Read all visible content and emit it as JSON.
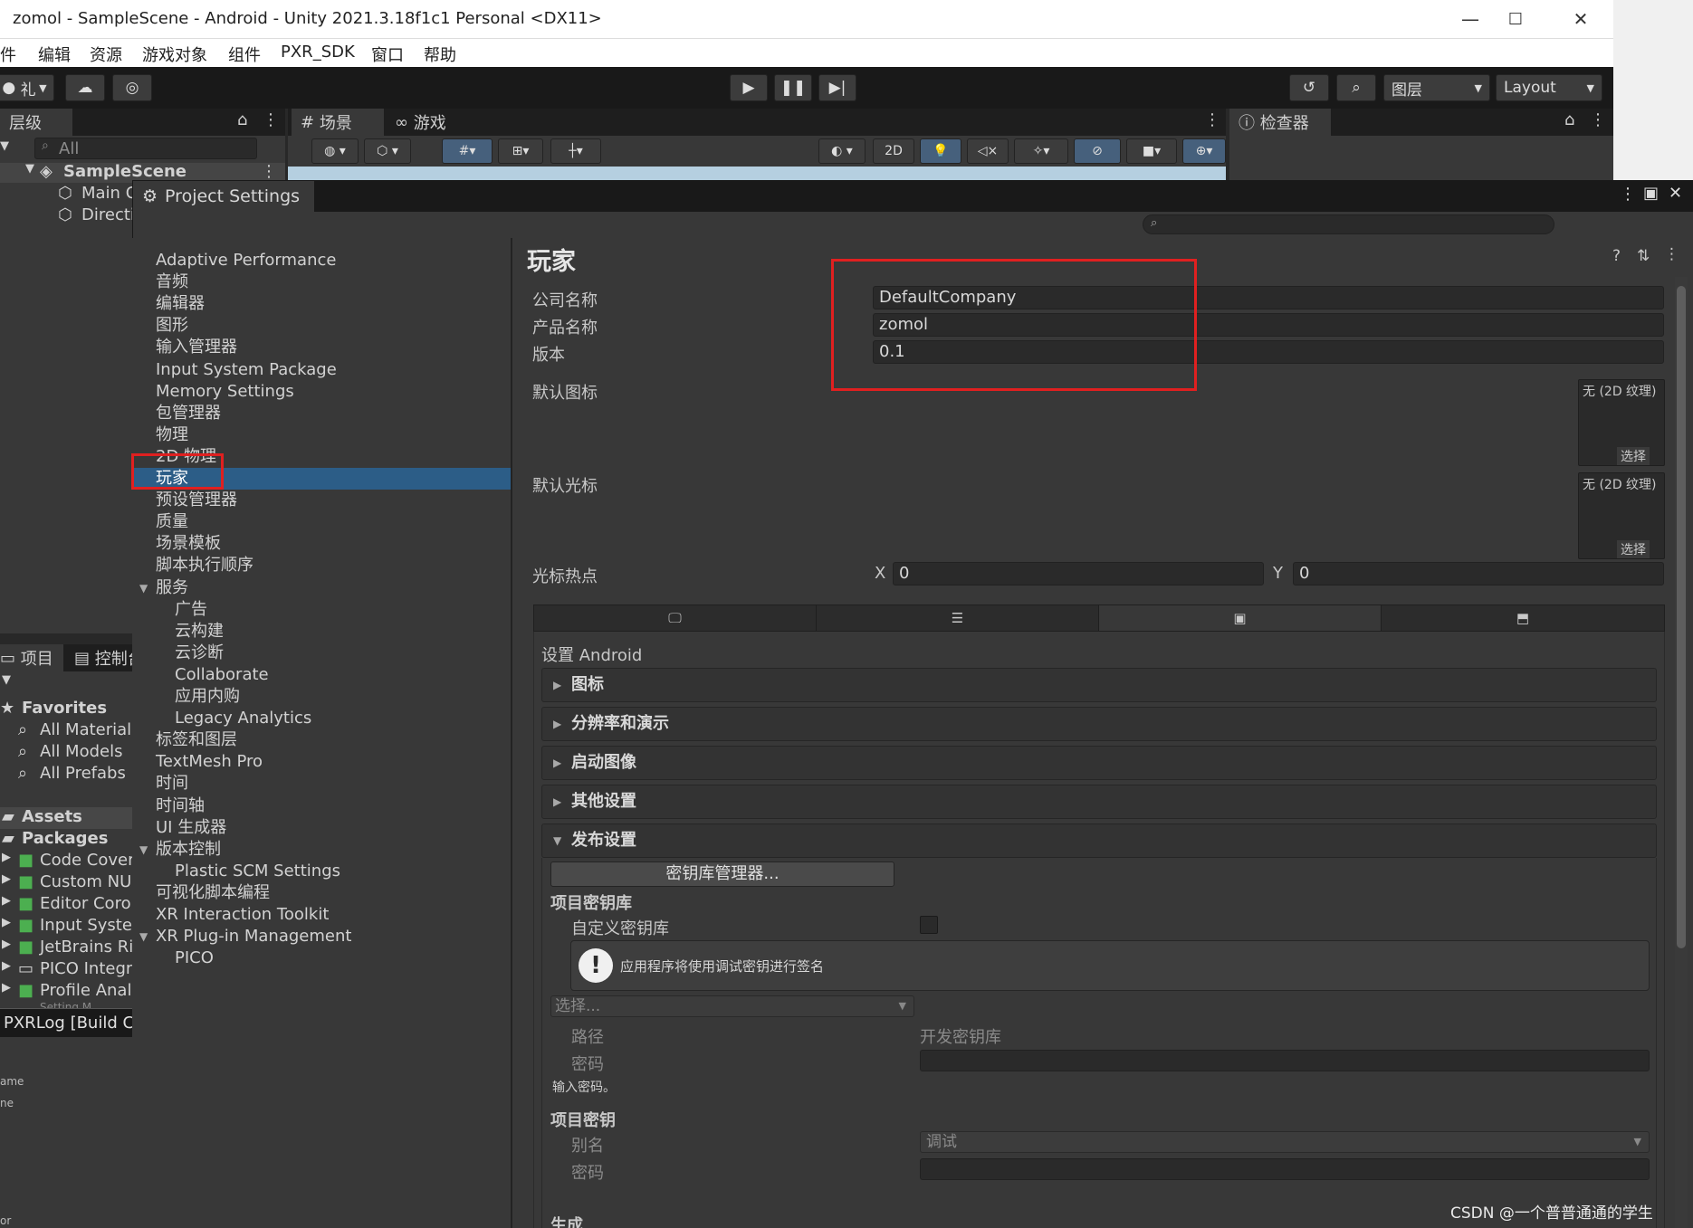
{
  "window": {
    "title": "zomol - SampleScene - Android - Unity 2021.3.18f1c1 Personal <DX11>",
    "minimize": "—",
    "maximize": "☐",
    "close": "✕"
  },
  "menu": [
    "件",
    "编辑",
    "资源",
    "游戏对象",
    "组件",
    "PXR_SDK",
    "窗口",
    "帮助"
  ],
  "toolbar": {
    "account_label": "礼",
    "layers_label": "图层",
    "layout_label": "Layout"
  },
  "hierarchy": {
    "tab": "层级",
    "search_placeholder": "All",
    "scene": "SampleScene",
    "items": [
      "Main C",
      "Directi"
    ]
  },
  "scene_tabs": [
    "场景",
    "游戏"
  ],
  "scene_toolbar": {
    "mode_2d": "2D"
  },
  "inspector": {
    "tab": "检查器"
  },
  "project": {
    "tabs": [
      "项目",
      "控制台"
    ],
    "favorites_label": "Favorites",
    "favorites": [
      "All Material",
      "All Models",
      "All Prefabs"
    ],
    "assets_label": "Assets",
    "packages_label": "Packages",
    "packages": [
      "Code Cover",
      "Custom NU",
      "Editor Coro",
      "Input Syster",
      "JetBrains Ri",
      "PICO Integr",
      "Profile Anal",
      "Setting M"
    ]
  },
  "console": {
    "log": "PXRLog [Build C",
    "lines": [
      "ame",
      "ne",
      "or"
    ]
  },
  "project_settings": {
    "title": "Project Settings",
    "nav": [
      {
        "label": "Adaptive Performance",
        "indent": 0
      },
      {
        "label": "音频",
        "indent": 0
      },
      {
        "label": "编辑器",
        "indent": 0
      },
      {
        "label": "图形",
        "indent": 0
      },
      {
        "label": "输入管理器",
        "indent": 0
      },
      {
        "label": "Input System Package",
        "indent": 0
      },
      {
        "label": "Memory Settings",
        "indent": 0
      },
      {
        "label": "包管理器",
        "indent": 0
      },
      {
        "label": "物理",
        "indent": 0
      },
      {
        "label": "2D 物理",
        "indent": 0
      },
      {
        "label": "玩家",
        "indent": 0,
        "selected": true
      },
      {
        "label": "预设管理器",
        "indent": 0
      },
      {
        "label": "质量",
        "indent": 0
      },
      {
        "label": "场景模板",
        "indent": 0
      },
      {
        "label": "脚本执行顺序",
        "indent": 0
      },
      {
        "label": "服务",
        "indent": 0,
        "expanded": true
      },
      {
        "label": "广告",
        "indent": 1
      },
      {
        "label": "云构建",
        "indent": 1
      },
      {
        "label": "云诊断",
        "indent": 1
      },
      {
        "label": "Collaborate",
        "indent": 1
      },
      {
        "label": "应用内购",
        "indent": 1
      },
      {
        "label": "Legacy Analytics",
        "indent": 1
      },
      {
        "label": "标签和图层",
        "indent": 0
      },
      {
        "label": "TextMesh Pro",
        "indent": 0
      },
      {
        "label": "时间",
        "indent": 0
      },
      {
        "label": "时间轴",
        "indent": 0
      },
      {
        "label": "UI 生成器",
        "indent": 0
      },
      {
        "label": "版本控制",
        "indent": 0,
        "expanded": true
      },
      {
        "label": "Plastic SCM Settings",
        "indent": 1
      },
      {
        "label": "可视化脚本编程",
        "indent": 0
      },
      {
        "label": "XR Interaction Toolkit",
        "indent": 0
      },
      {
        "label": "XR Plug-in Management",
        "indent": 0,
        "expanded": true
      },
      {
        "label": "PICO",
        "indent": 1
      }
    ],
    "player": {
      "heading": "玩家",
      "company_label": "公司名称",
      "company_value": "DefaultCompany",
      "product_label": "产品名称",
      "product_value": "zomol",
      "version_label": "版本",
      "version_value": "0.1",
      "default_icon_label": "默认图标",
      "default_cursor_label": "默认光标",
      "texture_none": "无 (2D 纹理)",
      "select_label": "选择",
      "hotspot_label": "光标热点",
      "hotspot_x_label": "X",
      "hotspot_x": "0",
      "hotspot_y_label": "Y",
      "hotspot_y": "0",
      "platform_settings_label": "设置 Android",
      "sections": [
        "图标",
        "分辨率和演示",
        "启动图像",
        "其他设置",
        "发布设置"
      ],
      "publish": {
        "keystore_manager_button": "密钥库管理器...",
        "project_keystore_label": "项目密钥库",
        "custom_keystore_label": "自定义密钥库",
        "info_text": "应用程序将使用调试密钥进行签名",
        "select_placeholder": "选择...",
        "path_label": "路径",
        "path_value": "开发密钥库",
        "password_label": "密码",
        "enter_password": "输入密码。",
        "project_key_label": "项目密钥",
        "alias_label": "别名",
        "alias_value": "调试",
        "key_password_label": "密码",
        "build_label": "生成"
      }
    }
  },
  "watermark": "CSDN @一个普普通通的学生",
  "colors": {
    "selection": "#2c5d87",
    "highlight_box": "#e02020"
  }
}
